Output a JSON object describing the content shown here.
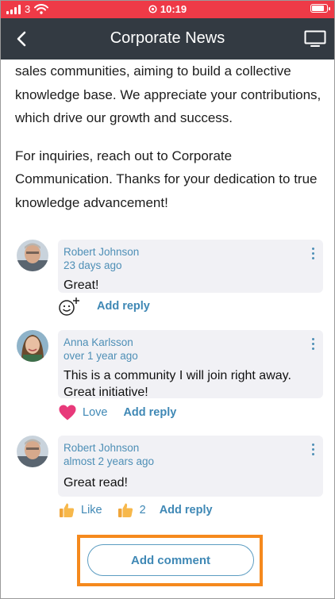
{
  "status": {
    "carrier": "3",
    "time": "10:19",
    "battery_level": 0.9,
    "color": "#ee3a47"
  },
  "header": {
    "title": "Corporate News",
    "background": "#333a42"
  },
  "article": {
    "paragraphs": [
      "sales communities, aiming to build a collective knowledge base. We appreciate your contributions, which drive our growth and success.",
      "For inquiries, reach out to Corporate Communication. Thanks for your dedication to true knowledge advancement!"
    ]
  },
  "comments": [
    {
      "author": "Robert Johnson",
      "date": "23 days ago",
      "text": "Great!",
      "reaction": "add-reaction-icon",
      "add_reply": "Add reply"
    },
    {
      "author": "Anna Karlsson",
      "date": "over 1 year ago",
      "text": "This is a community I will join right away. Great initiative!",
      "reaction_label": "Love",
      "add_reply": "Add reply"
    },
    {
      "author": "Robert Johnson",
      "date": "almost 2 years ago",
      "text": "Great read!",
      "reaction_label": "Like",
      "reaction_count": "2",
      "add_reply": "Add reply"
    }
  ],
  "add_comment": {
    "label": "Add comment",
    "highlight_color": "#f5891d"
  }
}
